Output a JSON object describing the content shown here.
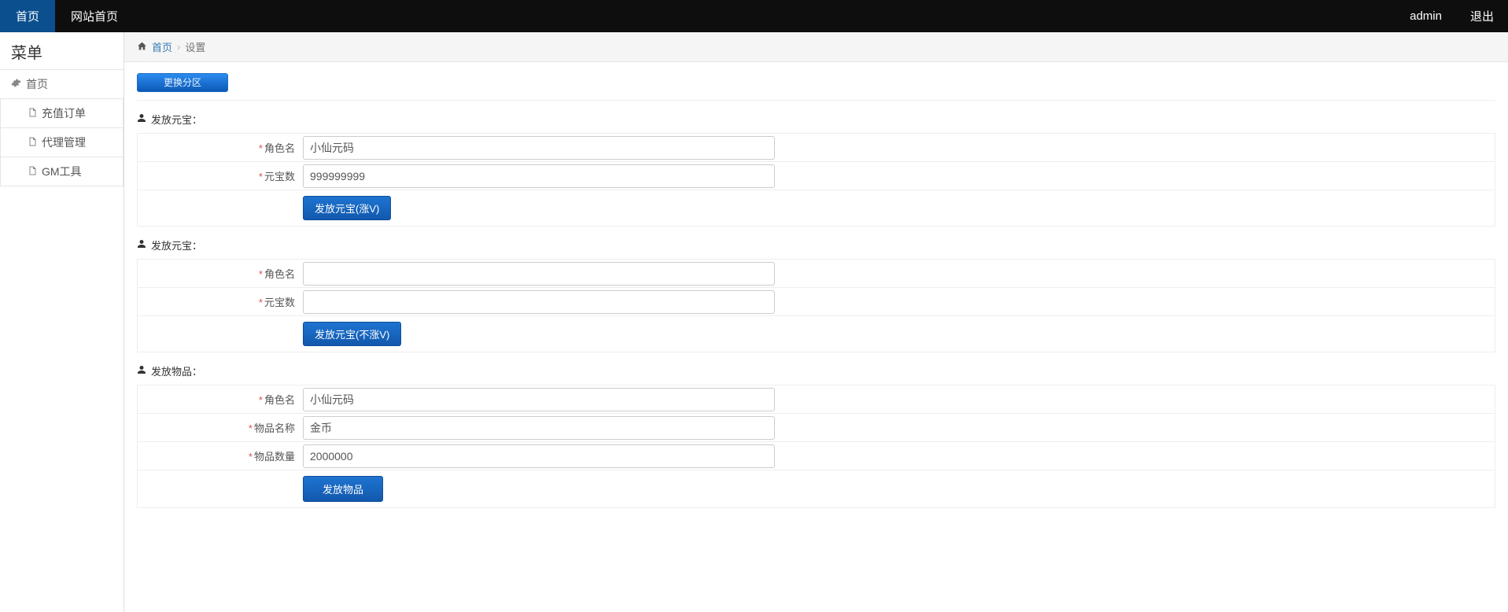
{
  "navbar": {
    "home": "首页",
    "site_home": "网站首页",
    "user": "admin",
    "logout": "退出"
  },
  "sidebar": {
    "title": "菜单",
    "group_home": "首页",
    "items": [
      "充值订单",
      "代理管理",
      "GM工具"
    ]
  },
  "breadcrumb": {
    "home": "首页",
    "current": "设置"
  },
  "buttons": {
    "change_zone": "更换分区"
  },
  "sections": {
    "grant_yuanbao_vip": {
      "title": "发放元宝：",
      "role_label": "角色名",
      "role_value": "小仙元码",
      "amount_label": "元宝数",
      "amount_value": "999999999",
      "submit": "发放元宝(涨V)"
    },
    "grant_yuanbao_novip": {
      "title": "发放元宝：",
      "role_label": "角色名",
      "role_value": "",
      "amount_label": "元宝数",
      "amount_value": "",
      "submit": "发放元宝(不涨V)"
    },
    "grant_item": {
      "title": "发放物品：",
      "role_label": "角色名",
      "role_value": "小仙元码",
      "item_name_label": "物品名称",
      "item_name_value": "金币",
      "item_qty_label": "物品数量",
      "item_qty_value": "2000000",
      "submit": "发放物品"
    }
  }
}
